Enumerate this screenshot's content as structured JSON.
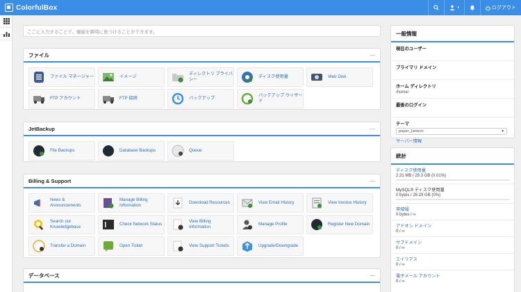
{
  "app": {
    "brand": "ColorfulBox"
  },
  "topbar": {
    "search_icon": "search-icon",
    "user_icon": "user-icon",
    "notify_icon": "bell-icon",
    "logout_label": "ログアウト"
  },
  "search": {
    "placeholder": "ここに入力することで、機能を瞬時に見つけることができます。"
  },
  "sections": {
    "files": {
      "title": "ファイル",
      "items": [
        {
          "label": "ファイル マネージャー",
          "icon": "file-manager-icon"
        },
        {
          "label": "イメージ",
          "icon": "image-icon"
        },
        {
          "label": "ディレクトリ プライバシー",
          "icon": "folder-privacy-icon"
        },
        {
          "label": "ディスク使用量",
          "icon": "disk-usage-icon"
        },
        {
          "label": "Web Disk",
          "icon": "web-disk-icon"
        },
        {
          "label": "FTP アカウント",
          "icon": "ftp-accounts-icon"
        },
        {
          "label": "FTP 接続",
          "icon": "ftp-connections-icon"
        },
        {
          "label": "バックアップ",
          "icon": "backup-icon"
        },
        {
          "label": "バックアップ ウィザード",
          "icon": "backup-wizard-icon"
        }
      ]
    },
    "jetbackup": {
      "title": "JetBackup",
      "items": [
        {
          "label": "File Backups",
          "icon": "file-backups-icon"
        },
        {
          "label": "Database Backups",
          "icon": "database-backups-icon"
        },
        {
          "label": "Queue",
          "icon": "queue-icon"
        }
      ]
    },
    "billing": {
      "title": "Billing & Support",
      "items": [
        {
          "label": "News & Announcements",
          "icon": "megaphone-icon"
        },
        {
          "label": "Manage Billing Information",
          "icon": "billing-info-icon"
        },
        {
          "label": "Download Resources",
          "icon": "download-icon"
        },
        {
          "label": "View Email History",
          "icon": "email-history-icon"
        },
        {
          "label": "View Invoice History",
          "icon": "invoice-history-icon"
        },
        {
          "label": "Search our Knowledgebase",
          "icon": "knowledgebase-icon"
        },
        {
          "label": "Check Network Status",
          "icon": "network-status-icon"
        },
        {
          "label": "View Billing Information",
          "icon": "billing-view-icon"
        },
        {
          "label": "Manage Profile",
          "icon": "profile-icon"
        },
        {
          "label": "Register New Domain",
          "icon": "register-domain-icon"
        },
        {
          "label": "Transfer a Domain",
          "icon": "transfer-domain-icon"
        },
        {
          "label": "Open Ticket",
          "icon": "open-ticket-icon"
        },
        {
          "label": "View Support Tickets",
          "icon": "support-tickets-icon"
        },
        {
          "label": "Upgrade/Downgrade",
          "icon": "upgrade-icon"
        }
      ]
    },
    "database": {
      "title": "データベース"
    }
  },
  "general": {
    "title": "一般情報",
    "current_user_label": "現在のユーザー",
    "current_user_value": "",
    "primary_domain_label": "プライマリ ドメイン",
    "primary_domain_value": "",
    "home_dir_label": "ホーム ディレクトリ",
    "home_dir_value": "/home/",
    "last_login_label": "最後のログイン",
    "last_login_value": "",
    "theme_label": "テーマ",
    "theme_value": "paper_lantern",
    "server_info_link": "サーバー情報"
  },
  "stats": {
    "title": "統計",
    "items": [
      {
        "label": "ディスク使用量",
        "value": "2.31 MB / 29.3 GB (0.01%)",
        "fraction": 0.0001
      },
      {
        "label": "MySQL® ディスク使用量",
        "value": "0 bytes / 29.29 GB (0%)",
        "fraction": 0.0
      },
      {
        "label": "帯域幅",
        "value": "0 bytes / ∞"
      },
      {
        "label": "アドオン ドメイン",
        "value": "0 / ∞"
      },
      {
        "label": "サブドメイン",
        "value": "0 / ∞"
      },
      {
        "label": "エイリアス",
        "value": "0 / ∞"
      },
      {
        "label": "電子メール アカウント",
        "value": "0 / ∞"
      }
    ]
  },
  "colors": {
    "accent": "#3a8ee6",
    "link": "#2a6ebb"
  }
}
